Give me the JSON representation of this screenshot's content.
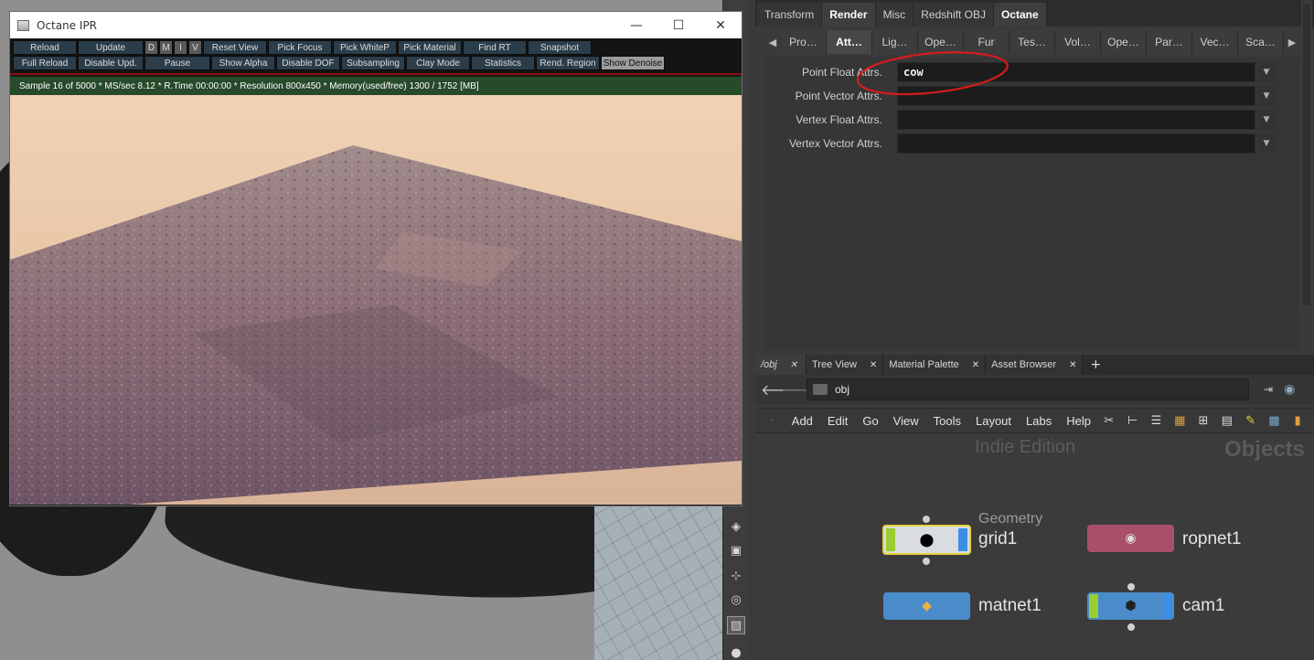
{
  "ipr": {
    "title": "Octane IPR",
    "toolbar_row1": [
      "Reload",
      "Update",
      "D",
      "M",
      "I",
      "V",
      "Reset View",
      "Pick Focus",
      "Pick WhiteP",
      "Pick Material",
      "Find RT",
      "Snapshot"
    ],
    "toolbar_row2": [
      "Full Reload",
      "Disable Upd.",
      "Pause",
      "Show Alpha",
      "Disable DOF",
      "Subsampling",
      "Clay Mode",
      "Statistics",
      "Rend. Region",
      "Show Denoise"
    ],
    "status": "Sample 16 of 5000 * MS/sec 8.12 * R.Time 00:00:00 * Resolution 800x450 * Memory(used/free) 1300 / 1752 [MB]"
  },
  "params": {
    "top_tabs": [
      "Transform",
      "Render",
      "Misc",
      "Redshift OBJ",
      "Octane"
    ],
    "sub_tabs": [
      "Pro…",
      "Att…",
      "Lig…",
      "Ope…",
      "Fur",
      "Tes…",
      "Vol…",
      "Ope…",
      "Par…",
      "Vec…",
      "Sca…"
    ],
    "fields": [
      {
        "label": "Point Float Attrs.",
        "value": "cow"
      },
      {
        "label": "Point Vector Attrs.",
        "value": ""
      },
      {
        "label": "Vertex Float Attrs.",
        "value": ""
      },
      {
        "label": "Vertex Vector Attrs.",
        "value": ""
      }
    ]
  },
  "network": {
    "tabs": [
      "/obj",
      "Tree View",
      "Material Palette",
      "Asset Browser"
    ],
    "path": "obj",
    "menu": [
      "Add",
      "Edit",
      "Go",
      "View",
      "Tools",
      "Layout",
      "Labs",
      "Help"
    ],
    "edition": "Indie Edition",
    "context": "Objects",
    "nodes": [
      {
        "name": "grid1",
        "type": "Geometry"
      },
      {
        "name": "ropnet1",
        "type": ""
      },
      {
        "name": "matnet1",
        "type": ""
      },
      {
        "name": "cam1",
        "type": ""
      }
    ]
  },
  "colors": {
    "status_bar": "#274a2a",
    "annotation": "#d41c1c",
    "toolbar_button": "#2b3d4a"
  }
}
